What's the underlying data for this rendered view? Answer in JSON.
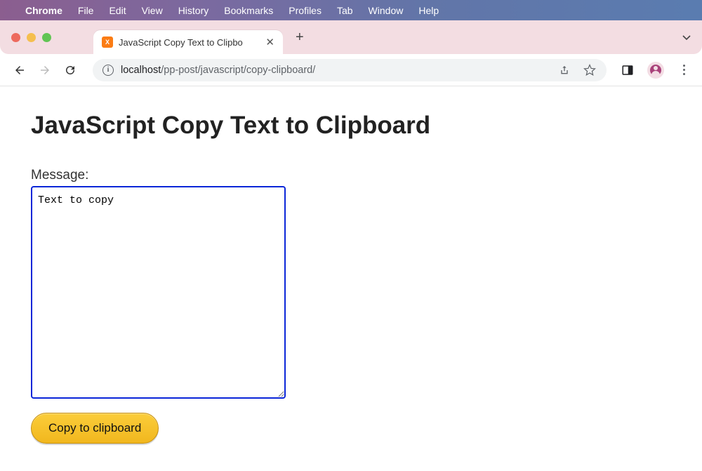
{
  "mac_menu": {
    "items": [
      "Chrome",
      "File",
      "Edit",
      "View",
      "History",
      "Bookmarks",
      "Profiles",
      "Tab",
      "Window",
      "Help"
    ]
  },
  "browser": {
    "tab_title": "JavaScript Copy Text to Clipbo",
    "url_host": "localhost",
    "url_path": "/pp-post/javascript/copy-clipboard/"
  },
  "page": {
    "heading": "JavaScript Copy Text to Clipboard",
    "label": "Message:",
    "textarea_value": "Text to copy",
    "button_label": "Copy to clipboard"
  }
}
